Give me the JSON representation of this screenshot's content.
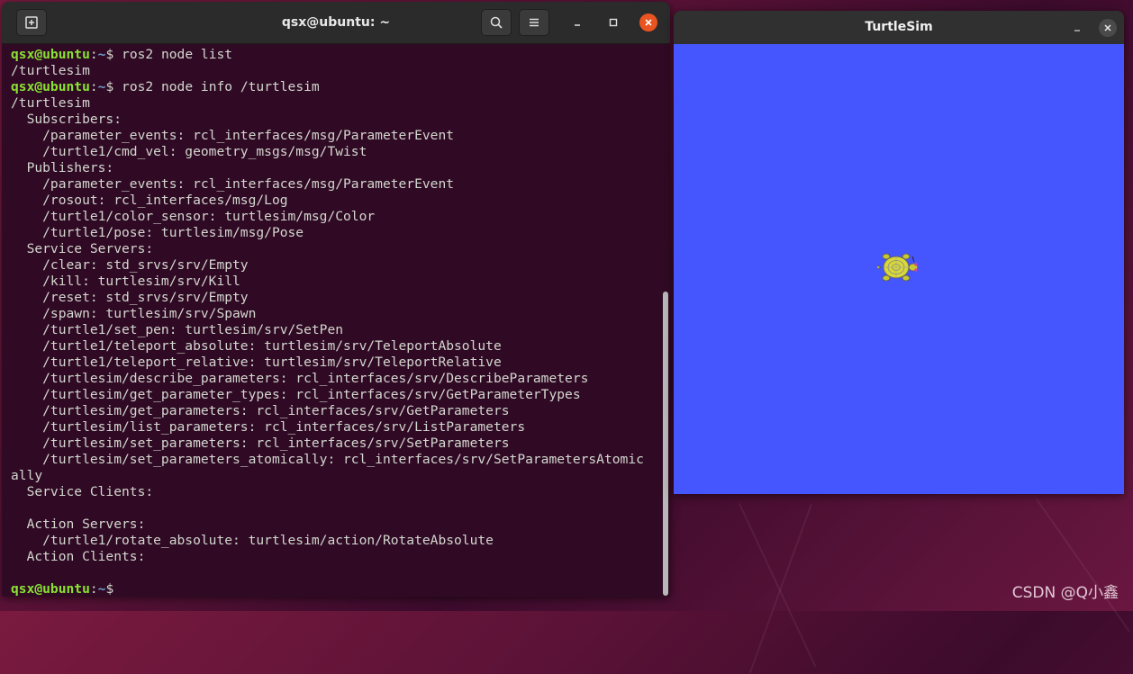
{
  "terminal": {
    "title": "qsx@ubuntu: ~",
    "icons": {
      "new_tab": "new-tab-icon",
      "search": "search-icon",
      "menu": "hamburger-menu-icon",
      "minimize": "minimize-icon",
      "maximize": "maximize-icon",
      "close": "close-icon"
    },
    "prompt_user": "qsx@ubuntu",
    "prompt_sep": ":",
    "prompt_path": "~",
    "prompt_symbol": "$ ",
    "lines": [
      {
        "type": "cmd",
        "text": "ros2 node list"
      },
      {
        "type": "out",
        "text": "/turtlesim"
      },
      {
        "type": "cmd",
        "text": "ros2 node info /turtlesim"
      },
      {
        "type": "out",
        "text": "/turtlesim"
      },
      {
        "type": "out",
        "text": "  Subscribers:"
      },
      {
        "type": "out",
        "text": "    /parameter_events: rcl_interfaces/msg/ParameterEvent"
      },
      {
        "type": "out",
        "text": "    /turtle1/cmd_vel: geometry_msgs/msg/Twist"
      },
      {
        "type": "out",
        "text": "  Publishers:"
      },
      {
        "type": "out",
        "text": "    /parameter_events: rcl_interfaces/msg/ParameterEvent"
      },
      {
        "type": "out",
        "text": "    /rosout: rcl_interfaces/msg/Log"
      },
      {
        "type": "out",
        "text": "    /turtle1/color_sensor: turtlesim/msg/Color"
      },
      {
        "type": "out",
        "text": "    /turtle1/pose: turtlesim/msg/Pose"
      },
      {
        "type": "out",
        "text": "  Service Servers:"
      },
      {
        "type": "out",
        "text": "    /clear: std_srvs/srv/Empty"
      },
      {
        "type": "out",
        "text": "    /kill: turtlesim/srv/Kill"
      },
      {
        "type": "out",
        "text": "    /reset: std_srvs/srv/Empty"
      },
      {
        "type": "out",
        "text": "    /spawn: turtlesim/srv/Spawn"
      },
      {
        "type": "out",
        "text": "    /turtle1/set_pen: turtlesim/srv/SetPen"
      },
      {
        "type": "out",
        "text": "    /turtle1/teleport_absolute: turtlesim/srv/TeleportAbsolute"
      },
      {
        "type": "out",
        "text": "    /turtle1/teleport_relative: turtlesim/srv/TeleportRelative"
      },
      {
        "type": "out",
        "text": "    /turtlesim/describe_parameters: rcl_interfaces/srv/DescribeParameters"
      },
      {
        "type": "out",
        "text": "    /turtlesim/get_parameter_types: rcl_interfaces/srv/GetParameterTypes"
      },
      {
        "type": "out",
        "text": "    /turtlesim/get_parameters: rcl_interfaces/srv/GetParameters"
      },
      {
        "type": "out",
        "text": "    /turtlesim/list_parameters: rcl_interfaces/srv/ListParameters"
      },
      {
        "type": "out",
        "text": "    /turtlesim/set_parameters: rcl_interfaces/srv/SetParameters"
      },
      {
        "type": "out",
        "text": "    /turtlesim/set_parameters_atomically: rcl_interfaces/srv/SetParametersAtomic"
      },
      {
        "type": "out",
        "text": "ally"
      },
      {
        "type": "out",
        "text": "  Service Clients:"
      },
      {
        "type": "out",
        "text": ""
      },
      {
        "type": "out",
        "text": "  Action Servers:"
      },
      {
        "type": "out",
        "text": "    /turtle1/rotate_absolute: turtlesim/action/RotateAbsolute"
      },
      {
        "type": "out",
        "text": "  Action Clients:"
      },
      {
        "type": "out",
        "text": ""
      },
      {
        "type": "cmd",
        "text": ""
      }
    ]
  },
  "turtlesim": {
    "title": "TurtleSim",
    "background_color": "#4556ff",
    "icons": {
      "minimize": "minimize-icon",
      "close": "close-icon",
      "turtle": "turtle-icon"
    }
  },
  "watermark": "CSDN @Q小鑫",
  "colors": {
    "terminal_bg": "#300a24",
    "prompt_user": "#8ae234",
    "prompt_path": "#729fcf",
    "text": "#d3d7cf",
    "close_button": "#e95420"
  }
}
